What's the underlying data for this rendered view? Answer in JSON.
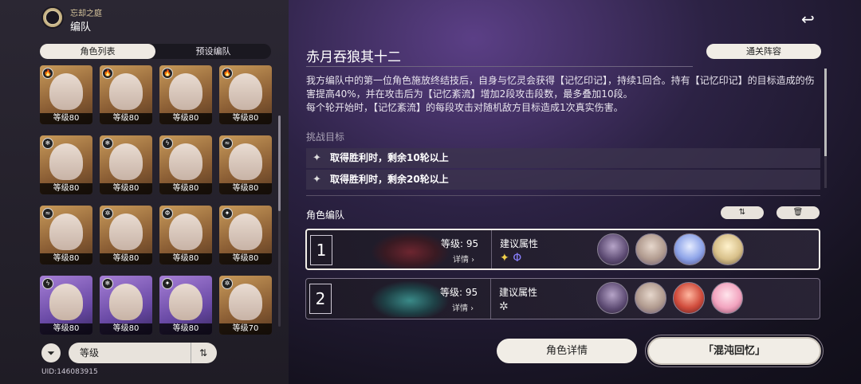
{
  "header": {
    "subtitle": "忘却之庭",
    "title": "编队"
  },
  "left_tabs": [
    "角色列表",
    "预设编队"
  ],
  "characters": [
    {
      "level": "等级80",
      "rarity": "gold",
      "element": "fire-icon"
    },
    {
      "level": "等级80",
      "rarity": "gold",
      "element": "fire-icon"
    },
    {
      "level": "等级80",
      "rarity": "gold",
      "element": "fire-icon"
    },
    {
      "level": "等级80",
      "rarity": "gold",
      "element": "fire-icon"
    },
    {
      "level": "等级80",
      "rarity": "gold",
      "element": "ice-icon"
    },
    {
      "level": "等级80",
      "rarity": "gold",
      "element": "ice-icon"
    },
    {
      "level": "等级80",
      "rarity": "gold",
      "element": "lightning-icon"
    },
    {
      "level": "等级80",
      "rarity": "gold",
      "element": "wind-icon"
    },
    {
      "level": "等级80",
      "rarity": "gold",
      "element": "wind-icon"
    },
    {
      "level": "等级80",
      "rarity": "gold",
      "element": "physical-icon"
    },
    {
      "level": "等级80",
      "rarity": "gold",
      "element": "quantum-icon"
    },
    {
      "level": "等级80",
      "rarity": "gold",
      "element": "imaginary-icon"
    },
    {
      "level": "等级80",
      "rarity": "purple",
      "element": "lightning-icon"
    },
    {
      "level": "等级80",
      "rarity": "purple",
      "element": "ice-icon"
    },
    {
      "level": "等级80",
      "rarity": "purple",
      "element": "imaginary-icon"
    },
    {
      "level": "等级70",
      "rarity": "gold",
      "element": "physical-icon"
    }
  ],
  "sort": {
    "label": "等级"
  },
  "uid": "UID:146083915",
  "stage": {
    "title": "赤月吞狼其十二",
    "clear_button": "通关阵容",
    "description": [
      "我方编队中的第一位角色施放终结技后，自身与忆灵会获得【记忆印记】，持续1回合。持有【记忆印记】的目标造成的伤害提高40%，并在攻击后为【记忆紊流】增加2段攻击段数，最多叠加10段。",
      "每个轮开始时，【记忆紊流】的每段攻击对随机敌方目标造成1次真实伤害。"
    ],
    "challenge_label": "挑战目标",
    "goals": [
      "取得胜利时，剩余10轮以上",
      "取得胜利时，剩余20轮以上"
    ]
  },
  "team": {
    "label": "角色编队",
    "rows": [
      {
        "num": "1",
        "level": "等级: 95",
        "detail": "详情",
        "attr_label": "建议属性",
        "attrs": [
          "✦",
          "Φ"
        ]
      },
      {
        "num": "2",
        "level": "等级: 95",
        "detail": "详情",
        "attr_label": "建议属性",
        "attrs": [
          "✲"
        ]
      }
    ]
  },
  "buttons": {
    "char_detail": "角色详情",
    "start": "「混沌回忆」"
  }
}
